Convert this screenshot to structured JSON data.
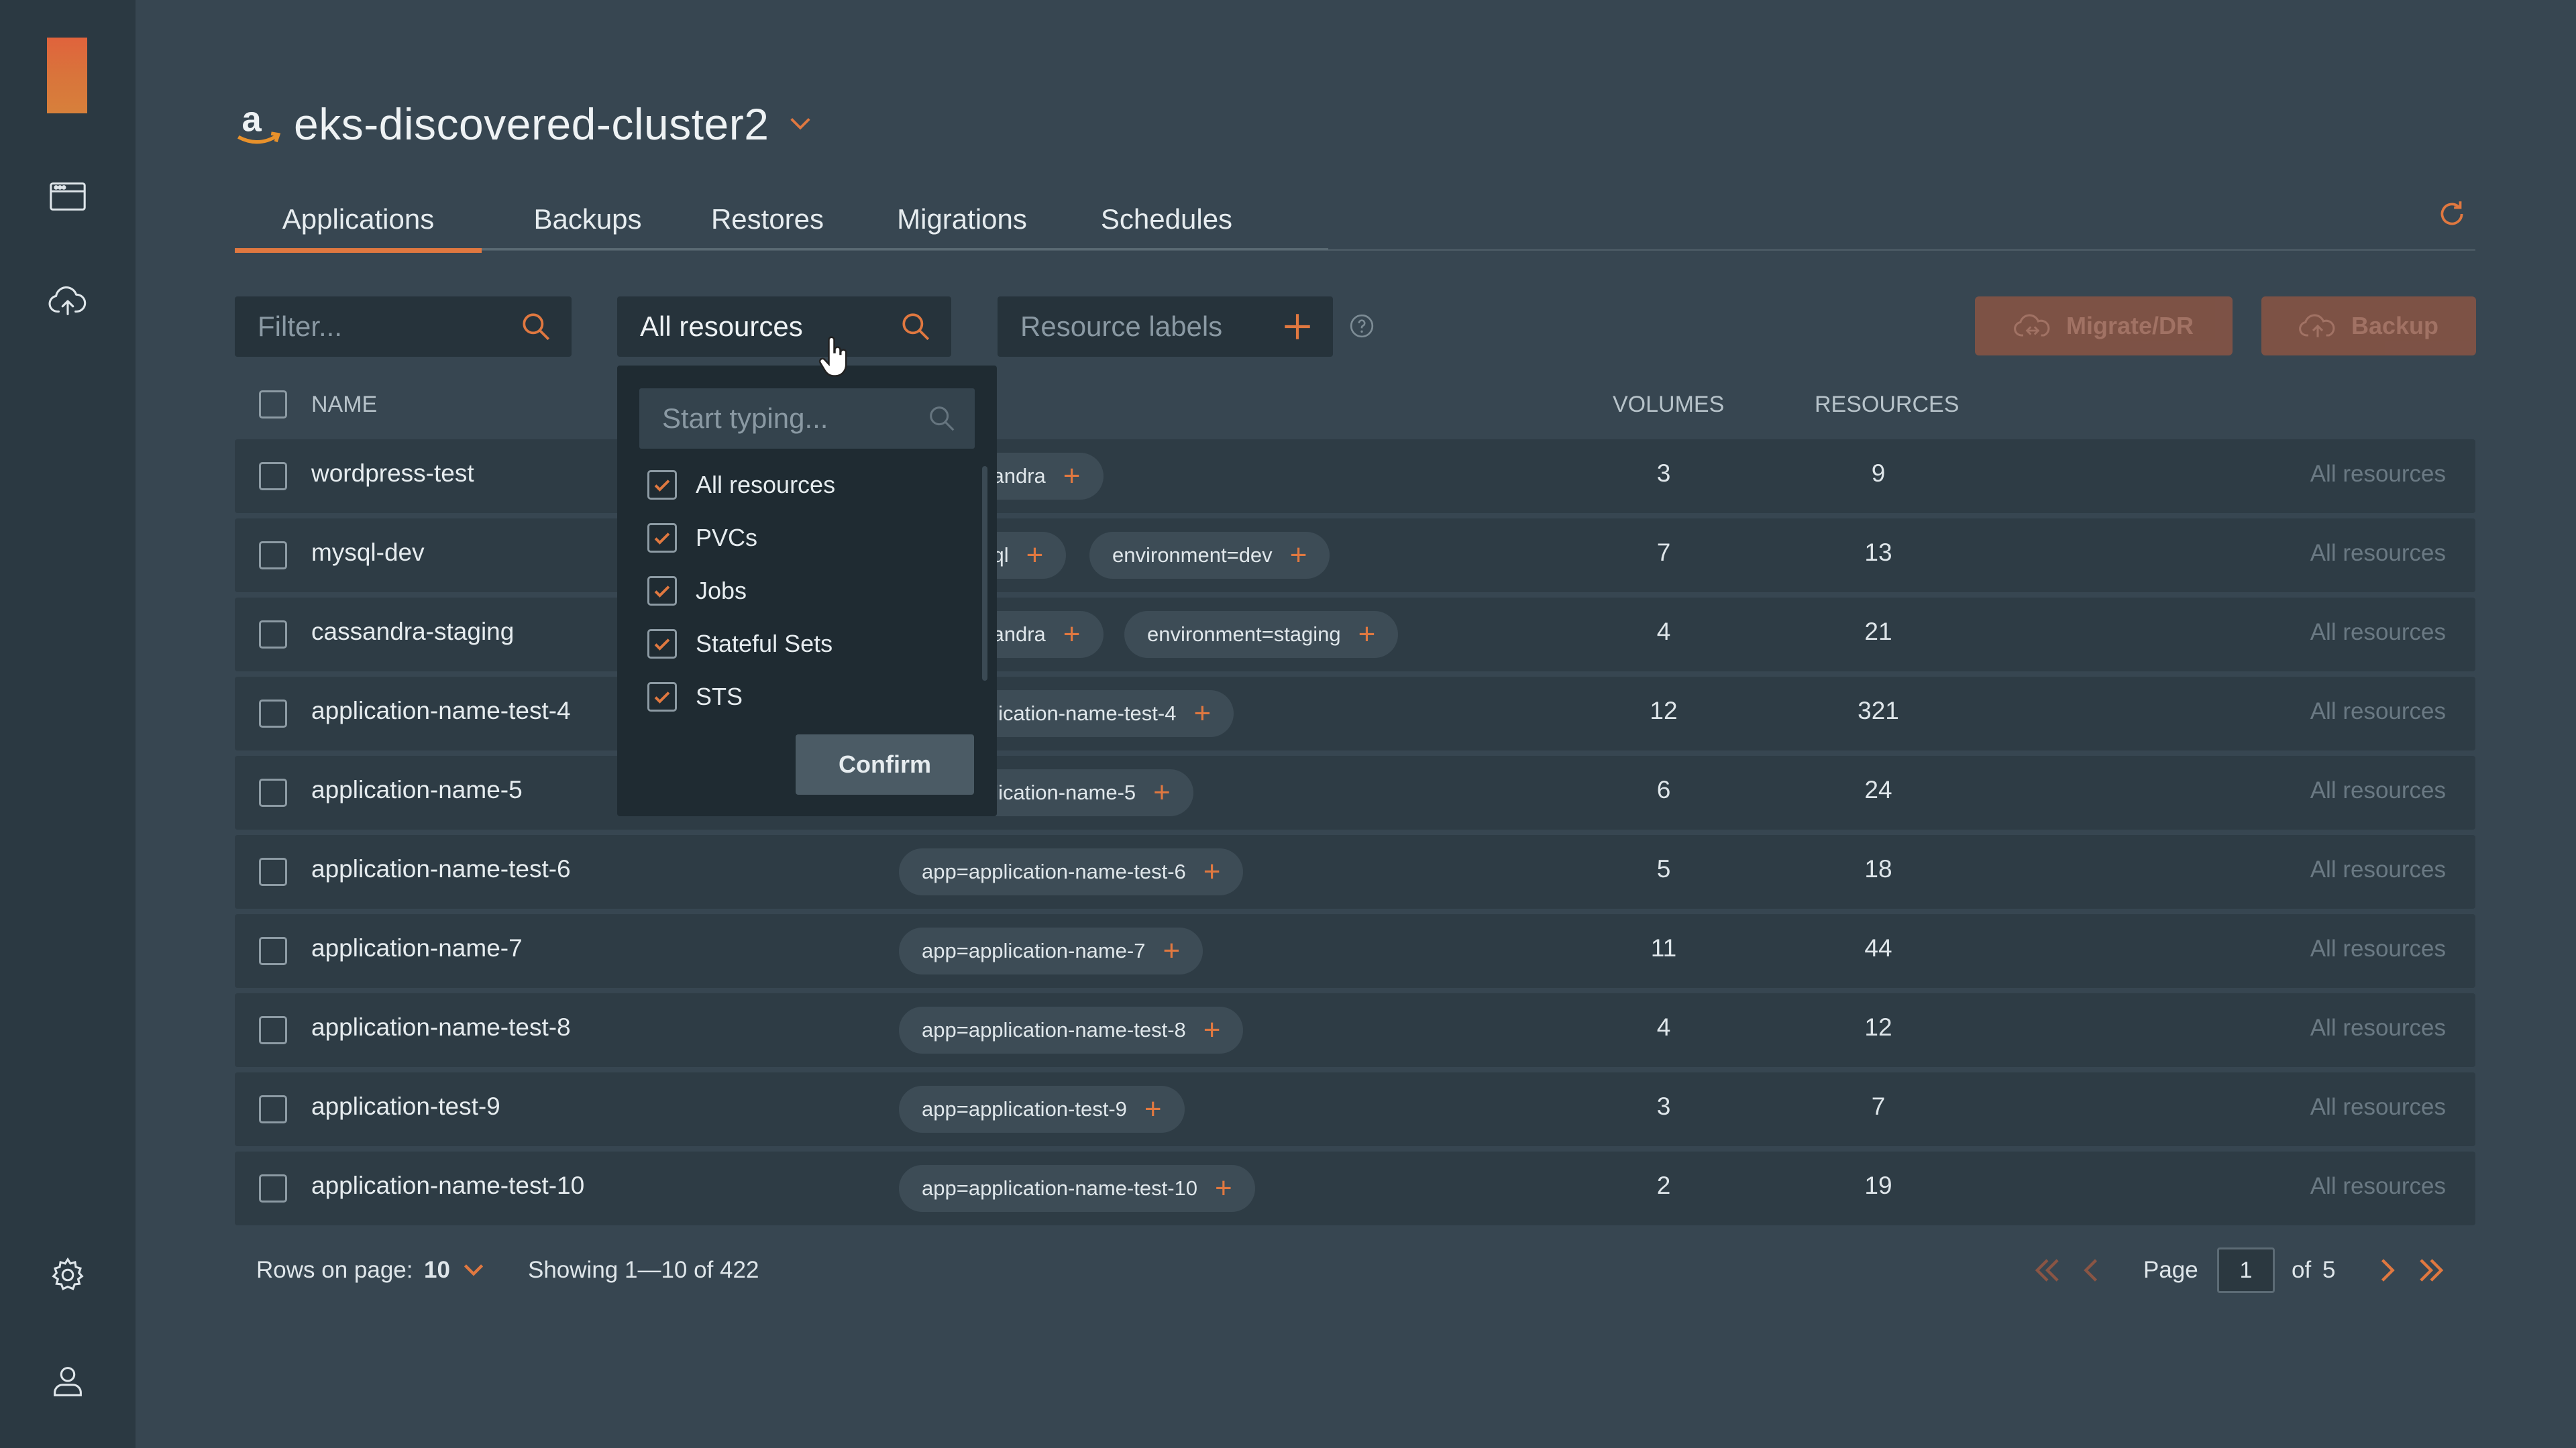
{
  "colors": {
    "accent": "#e07840",
    "sidebar": "#2b3942",
    "background": "#374651"
  },
  "sidebar": {
    "icons": [
      "browser-window-icon",
      "cloud-upload-icon",
      "gear-icon",
      "user-icon"
    ]
  },
  "header": {
    "cluster_name": "eks-discovered-cluster2",
    "provider_icon": "amazon-icon"
  },
  "tabs": [
    {
      "label": "Applications",
      "active": true
    },
    {
      "label": "Backups"
    },
    {
      "label": "Restores"
    },
    {
      "label": "Migrations"
    },
    {
      "label": "Schedules"
    }
  ],
  "toolbar": {
    "filter_placeholder": "Filter...",
    "resource_select_value": "All resources",
    "resource_labels_placeholder": "Resource labels",
    "migrate_label": "Migrate/DR",
    "backup_label": "Backup"
  },
  "table": {
    "columns": {
      "name": "NAME",
      "volumes": "VOLUMES",
      "resources": "RESOURCES"
    },
    "rows": [
      {
        "name": "wordpress-test",
        "labels": [
          "sandra"
        ],
        "volumes": "3",
        "resources": "9",
        "scope": "All resources"
      },
      {
        "name": "mysql-dev",
        "labels": [
          "sql",
          "environment=dev"
        ],
        "volumes": "7",
        "resources": "13",
        "scope": "All resources"
      },
      {
        "name": "cassandra-staging",
        "labels": [
          "sandra",
          "environment=staging"
        ],
        "volumes": "4",
        "resources": "21",
        "scope": "All resources"
      },
      {
        "name": "application-name-test-4",
        "labels": [
          "plication-name-test-4"
        ],
        "volumes": "12",
        "resources": "321",
        "scope": "All resources"
      },
      {
        "name": "application-name-5",
        "labels": [
          "plication-name-5"
        ],
        "volumes": "6",
        "resources": "24",
        "scope": "All resources"
      },
      {
        "name": "application-name-test-6",
        "labels": [
          "app=application-name-test-6"
        ],
        "volumes": "5",
        "resources": "18",
        "scope": "All resources"
      },
      {
        "name": "application-name-7",
        "labels": [
          "app=application-name-7"
        ],
        "volumes": "11",
        "resources": "44",
        "scope": "All resources"
      },
      {
        "name": "application-name-test-8",
        "labels": [
          "app=application-name-test-8"
        ],
        "volumes": "4",
        "resources": "12",
        "scope": "All resources"
      },
      {
        "name": "application-test-9",
        "labels": [
          "app=application-test-9"
        ],
        "volumes": "3",
        "resources": "7",
        "scope": "All resources"
      },
      {
        "name": "application-name-test-10",
        "labels": [
          "app=application-name-test-10"
        ],
        "volumes": "2",
        "resources": "19",
        "scope": "All resources"
      }
    ]
  },
  "dropdown": {
    "search_placeholder": "Start typing...",
    "options": [
      {
        "label": "All resources",
        "checked": true
      },
      {
        "label": "PVCs",
        "checked": true
      },
      {
        "label": "Jobs",
        "checked": true
      },
      {
        "label": "Stateful Sets",
        "checked": true
      },
      {
        "label": "STS",
        "checked": true
      }
    ],
    "confirm_label": "Confirm"
  },
  "footer": {
    "rows_label": "Rows on page:",
    "rows_value": "10",
    "showing": "Showing 1—10 of 422",
    "page_label": "Page",
    "page_value": "1",
    "of_label": "of",
    "total_pages": "5"
  }
}
